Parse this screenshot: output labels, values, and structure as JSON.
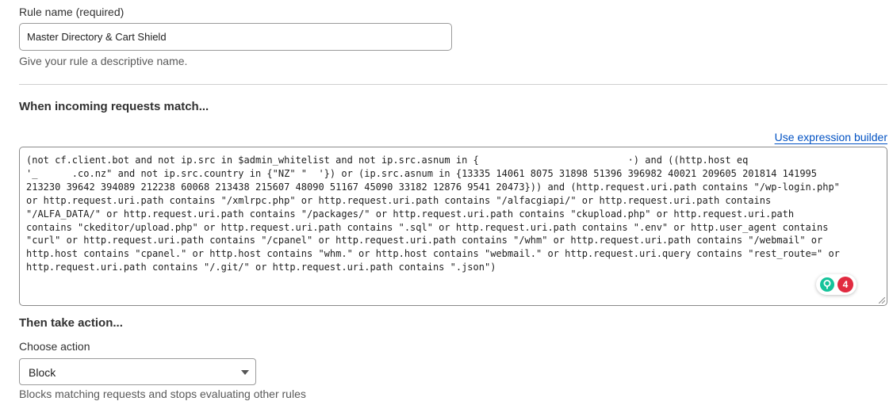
{
  "rule_name": {
    "label": "Rule name (required)",
    "value": "Master Directory & Cart Shield",
    "help": "Give your rule a descriptive name."
  },
  "match_section": {
    "heading": "When incoming requests match...",
    "builder_link": "Use expression builder",
    "expression": "(not cf.client.bot and not ip.src in $admin_whitelist and not ip.src.asnum in {                          ·) and ((http.host eq\n'_      .co.nz\" and not ip.src.country in {\"NZ\" \"  '}) or (ip.src.asnum in {13335 14061 8075 31898 51396 396982 40021 209605 201814 141995\n213230 39642 394089 212238 60068 213438 215607 48090 51167 45090 33182 12876 9541 20473})) and (http.request.uri.path contains \"/wp-login.php\"\nor http.request.uri.path contains \"/xmlrpc.php\" or http.request.uri.path contains \"/alfacgiapi/\" or http.request.uri.path contains\n\"/ALFA_DATA/\" or http.request.uri.path contains \"/packages/\" or http.request.uri.path contains \"ckupload.php\" or http.request.uri.path\ncontains \"ckeditor/upload.php\" or http.request.uri.path contains \".sql\" or http.request.uri.path contains \".env\" or http.user_agent contains\n\"curl\" or http.request.uri.path contains \"/cpanel\" or http.request.uri.path contains \"/whm\" or http.request.uri.path contains \"/webmail\" or\nhttp.host contains \"cpanel.\" or http.host contains \"whm.\" or http.host contains \"webmail.\" or http.request.uri.query contains \"rest_route=\" or\nhttp.request.uri.path contains \"/.git/\" or http.request.uri.path contains \".json\")",
    "grammar_issue_count": "4",
    "grammar_icon": "grammarly-logo-icon"
  },
  "action_section": {
    "heading": "Then take action...",
    "choose_label": "Choose action",
    "selected": "Block",
    "help": "Blocks matching requests and stops evaluating other rules"
  },
  "colors": {
    "link": "#0051c3",
    "grammar_badge": "#e12a40",
    "grammar_logo": "#15c39a"
  }
}
